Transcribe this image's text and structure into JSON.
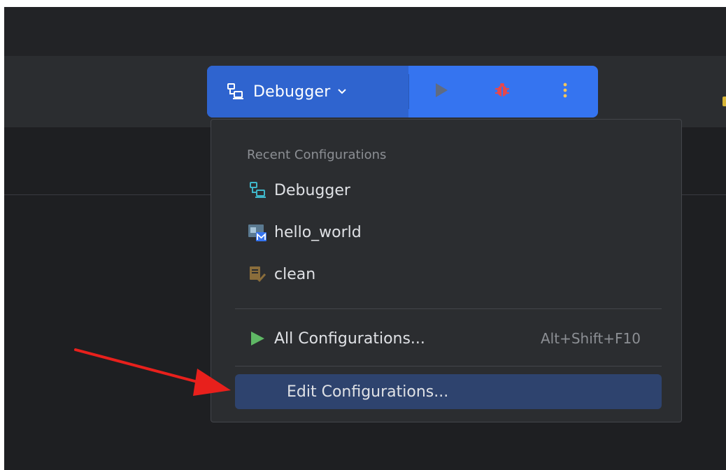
{
  "toolbar": {
    "config_selector": {
      "label": "Debugger",
      "icon": "remote-debug-icon"
    },
    "buttons": [
      {
        "name": "run-button",
        "icon": "play-icon"
      },
      {
        "name": "debug-button",
        "icon": "bug-icon"
      },
      {
        "name": "more-button",
        "icon": "kebab-vertical-icon"
      }
    ]
  },
  "menu": {
    "section_title": "Recent Configurations",
    "recent": [
      {
        "label": "Debugger",
        "icon": "remote-debug-icon"
      },
      {
        "label": "hello_world",
        "icon": "makefile-app-icon"
      },
      {
        "label": "clean",
        "icon": "build-target-icon"
      }
    ],
    "all_configs": {
      "label": "All Configurations...",
      "shortcut": "Alt+Shift+F10",
      "icon": "play-icon"
    },
    "edit_configs": {
      "label": "Edit Configurations..."
    }
  },
  "colors": {
    "accent_blue": "#3574f0",
    "selected_row": "#2e436e",
    "run_green": "#5fb865",
    "debug_red": "#e5484d",
    "kebab_yellow": "#f2c55c",
    "annotation_arrow": "#e8201c"
  }
}
